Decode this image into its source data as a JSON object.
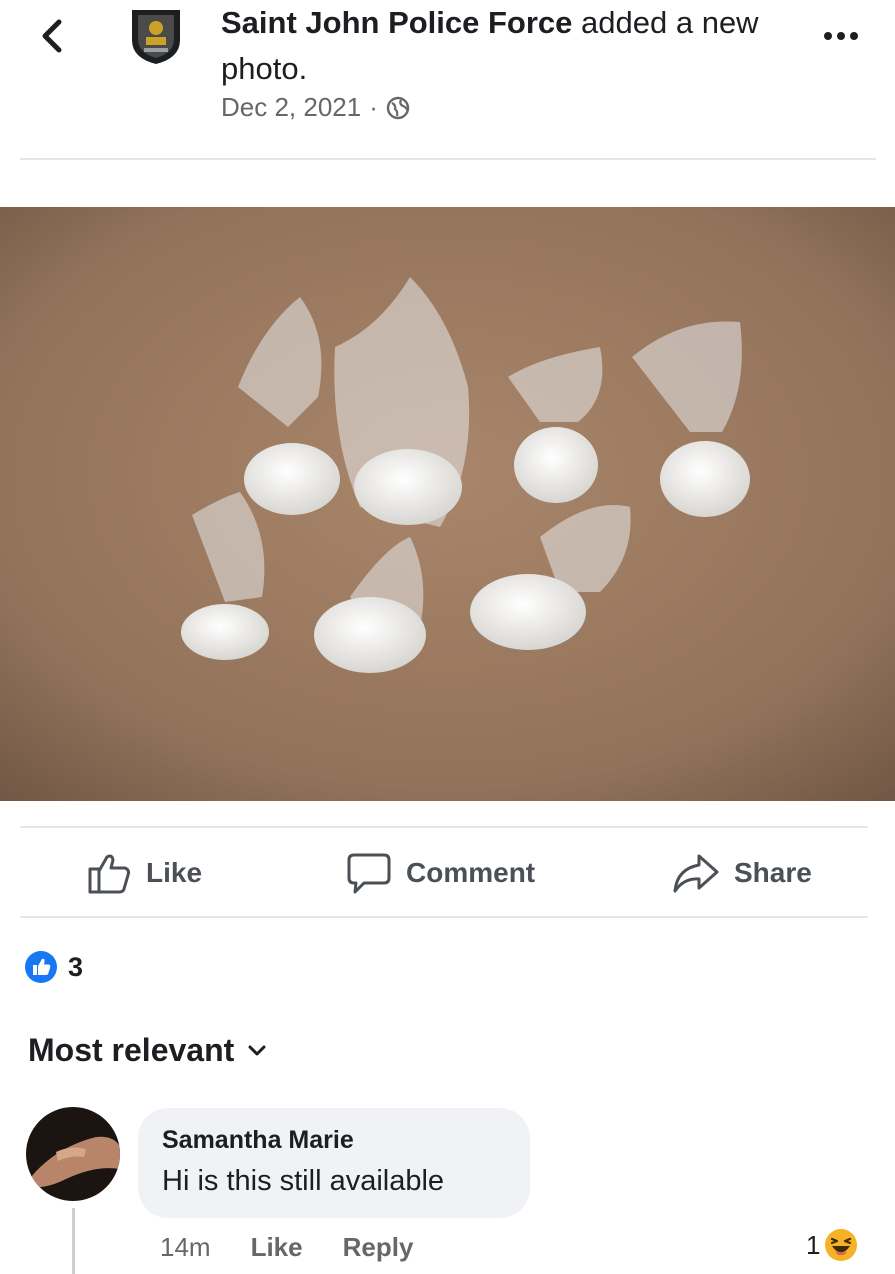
{
  "header": {
    "page_name": "Saint John Police Force",
    "action_text": " added a new photo.",
    "date": "Dec 2, 2021",
    "separator": "·",
    "icons": {
      "back": "chevron-left-icon",
      "privacy": "globe-icon",
      "more": "more-options-icon"
    }
  },
  "photo": {
    "subject": "plastic bags of white powder on brown paper"
  },
  "actions": {
    "like": "Like",
    "comment": "Comment",
    "share": "Share"
  },
  "reactions": {
    "count": "3",
    "icon": "like-reaction-icon",
    "color": "#1877f2"
  },
  "comments_sort": {
    "label": "Most relevant",
    "icon": "chevron-down-icon"
  },
  "comment": {
    "author": "Samantha Marie",
    "text": "Hi is this still available",
    "time": "14m",
    "like_label": "Like",
    "reply_label": "Reply",
    "reaction_count": "1",
    "reaction_icon": "haha-reaction-icon"
  }
}
